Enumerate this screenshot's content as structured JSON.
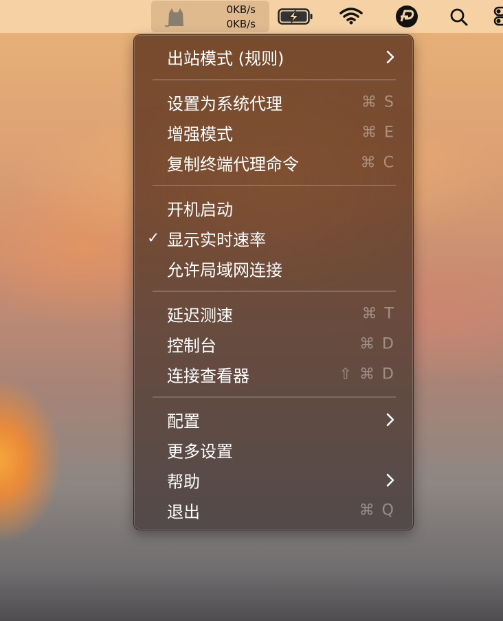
{
  "menubar": {
    "speed_up": "0KB/s",
    "speed_down": "0KB/s",
    "icons": [
      "cat-icon",
      "battery-charging-icon",
      "wifi-icon",
      "p-app-icon",
      "search-icon",
      "control-center-icon"
    ]
  },
  "menu": {
    "outbound_mode": {
      "label": "出站模式 (规则)"
    },
    "set_system_proxy": {
      "label": "设置为系统代理",
      "shortcut": "⌘ S"
    },
    "enhanced_mode": {
      "label": "增强模式",
      "shortcut": "⌘ E"
    },
    "copy_terminal_cmd": {
      "label": "复制终端代理命令",
      "shortcut": "⌘ C"
    },
    "launch_at_login": {
      "label": "开机启动"
    },
    "show_speed": {
      "label": "显示实时速率",
      "checked": "✓"
    },
    "allow_lan": {
      "label": "允许局域网连接"
    },
    "latency_test": {
      "label": "延迟测速",
      "shortcut": "⌘ T"
    },
    "dashboard": {
      "label": "控制台",
      "shortcut": "⌘ D"
    },
    "connection_viewer": {
      "label": "连接查看器",
      "shortcut": "⇧ ⌘ D"
    },
    "config": {
      "label": "配置"
    },
    "more_settings": {
      "label": "更多设置"
    },
    "help": {
      "label": "帮助"
    },
    "quit": {
      "label": "退出",
      "shortcut": "⌘ Q"
    }
  },
  "colors": {
    "menu_bg": "#6e4428",
    "menubar_bg": "#f6d4a8",
    "text": "#ffffff",
    "shortcut_text": "#9a8a80"
  }
}
